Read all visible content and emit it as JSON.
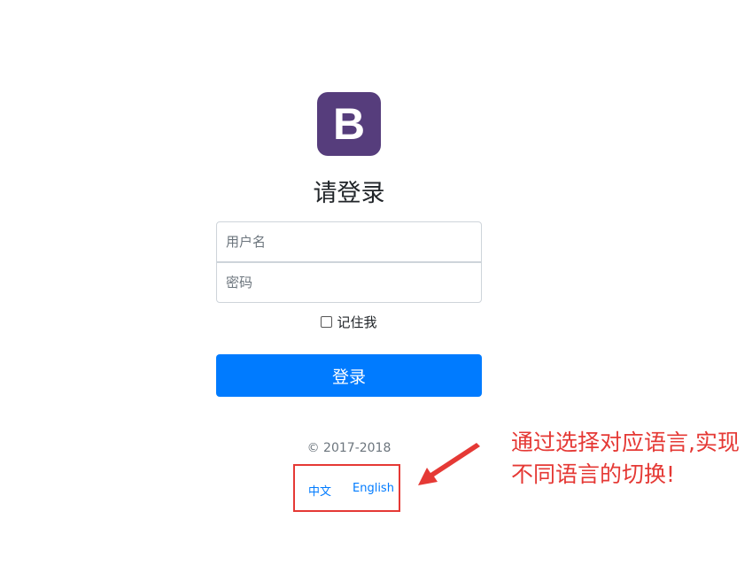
{
  "logo": {
    "letter": "B",
    "color": "#563d7c"
  },
  "heading": "请登录",
  "form": {
    "username_placeholder": "用户名",
    "password_placeholder": "密码",
    "remember_label": "记住我",
    "submit_label": "登录"
  },
  "footer": {
    "copyright": "© 2017-2018",
    "languages": [
      "中文",
      "English"
    ]
  },
  "annotation": {
    "text": "通过选择对应语言,实现不同语言的切换!",
    "color": "#e53935"
  },
  "colors": {
    "primary": "#007bff",
    "brand": "#563d7c",
    "annotation_red": "#e53935"
  }
}
